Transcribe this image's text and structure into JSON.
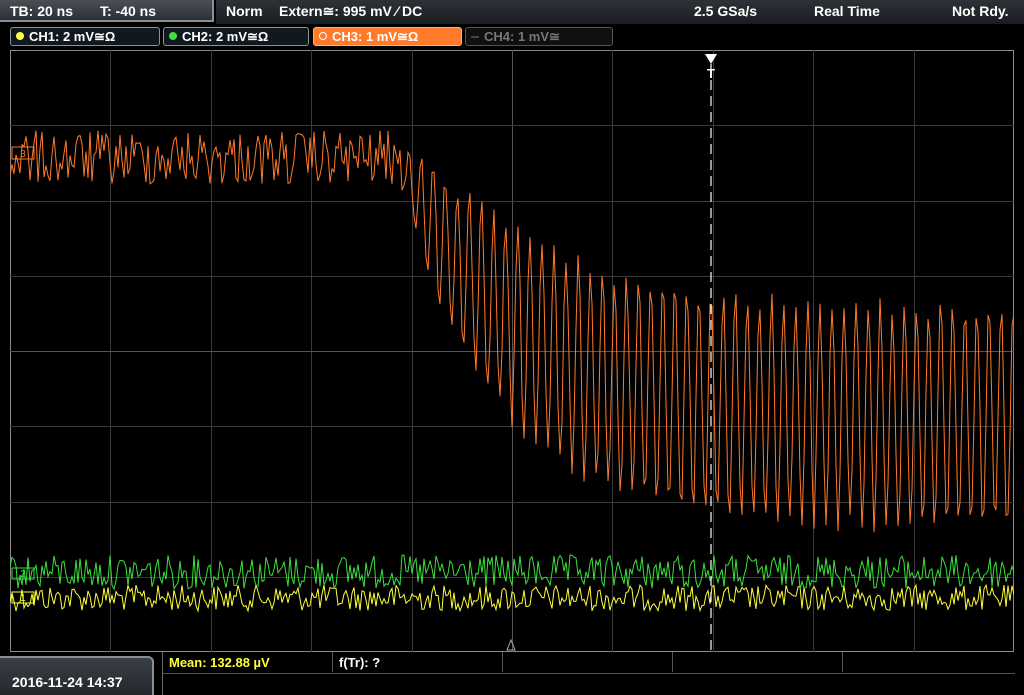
{
  "timebase": {
    "tb": "TB: 20 ns",
    "offset": "T: -40 ns"
  },
  "status": {
    "mode": "Norm",
    "trigger": "Extern≅: 995 mV ⁄ DC",
    "sample_rate": "2.5 GSa/s",
    "acq_mode": "Real Time",
    "ready": "Not Rdy."
  },
  "channels": [
    {
      "label": "CH1: 2 mV≅Ω",
      "color": "#ffff40",
      "active": true
    },
    {
      "label": "CH2: 2 mV≅Ω",
      "color": "#40e040",
      "active": true
    },
    {
      "label": "CH3: 1 mV≅Ω",
      "color": "#ff7a2a",
      "active": true,
      "selected": true
    },
    {
      "label": "CH4: 1 mV≅",
      "color": "#666666",
      "active": false
    }
  ],
  "markers": {
    "ch3": "3",
    "ch2": "2",
    "ch1": "1",
    "trigger": "T"
  },
  "datetime": "2016-11-24 14:37",
  "measurements": {
    "mean": "Mean: 132.88 µV",
    "ftr": "f(Tr): ?"
  },
  "colors": {
    "ch1": "#ffff3a",
    "ch2": "#3ce03c",
    "ch3": "#ff7a2a",
    "grid": "#3a3a3a"
  }
}
